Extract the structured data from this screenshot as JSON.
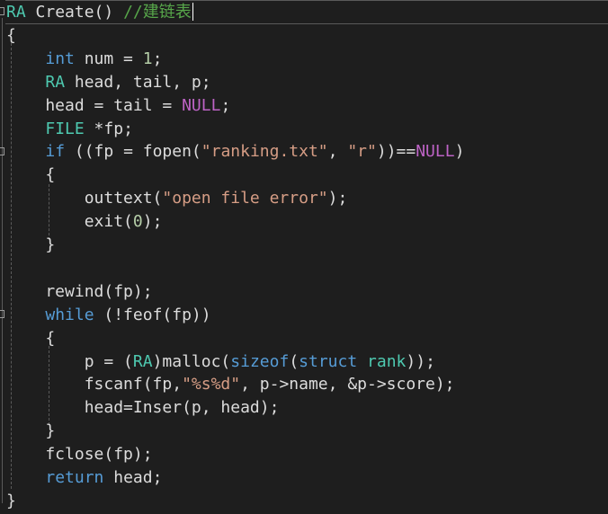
{
  "editor": {
    "lines": [
      [
        {
          "text": "RA",
          "c": "#4ec9b0"
        },
        {
          "text": " Create() ",
          "c": "#dcdcdc"
        },
        {
          "text": "//建链表",
          "c": "#57a64a"
        }
      ],
      [
        {
          "text": "{",
          "c": "#dcdcdc"
        }
      ],
      [
        {
          "text": "    ",
          "c": "#dcdcdc"
        },
        {
          "text": "int",
          "c": "#569cd6"
        },
        {
          "text": " num = ",
          "c": "#dcdcdc"
        },
        {
          "text": "1",
          "c": "#b5cea8"
        },
        {
          "text": ";",
          "c": "#dcdcdc"
        }
      ],
      [
        {
          "text": "    ",
          "c": "#dcdcdc"
        },
        {
          "text": "RA",
          "c": "#4ec9b0"
        },
        {
          "text": " head, tail, p;",
          "c": "#dcdcdc"
        }
      ],
      [
        {
          "text": "    head = tail = ",
          "c": "#dcdcdc"
        },
        {
          "text": "NULL",
          "c": "#bd63c5"
        },
        {
          "text": ";",
          "c": "#dcdcdc"
        }
      ],
      [
        {
          "text": "    ",
          "c": "#dcdcdc"
        },
        {
          "text": "FILE",
          "c": "#4ec9b0"
        },
        {
          "text": " *fp;",
          "c": "#dcdcdc"
        }
      ],
      [
        {
          "text": "    ",
          "c": "#dcdcdc"
        },
        {
          "text": "if",
          "c": "#569cd6"
        },
        {
          "text": " ((fp = fopen(",
          "c": "#dcdcdc"
        },
        {
          "text": "\"ranking.txt\"",
          "c": "#d69d85"
        },
        {
          "text": ", ",
          "c": "#dcdcdc"
        },
        {
          "text": "\"r\"",
          "c": "#d69d85"
        },
        {
          "text": "))==",
          "c": "#dcdcdc"
        },
        {
          "text": "NULL",
          "c": "#bd63c5"
        },
        {
          "text": ")",
          "c": "#dcdcdc"
        }
      ],
      [
        {
          "text": "    {",
          "c": "#dcdcdc"
        }
      ],
      [
        {
          "text": "        outtext(",
          "c": "#dcdcdc"
        },
        {
          "text": "\"open file error\"",
          "c": "#d69d85"
        },
        {
          "text": ");",
          "c": "#dcdcdc"
        }
      ],
      [
        {
          "text": "        exit(",
          "c": "#dcdcdc"
        },
        {
          "text": "0",
          "c": "#b5cea8"
        },
        {
          "text": ");",
          "c": "#dcdcdc"
        }
      ],
      [
        {
          "text": "    }",
          "c": "#dcdcdc"
        }
      ],
      [],
      [
        {
          "text": "    rewind(fp);",
          "c": "#dcdcdc"
        }
      ],
      [
        {
          "text": "    ",
          "c": "#dcdcdc"
        },
        {
          "text": "while",
          "c": "#569cd6"
        },
        {
          "text": " (!feof(fp))",
          "c": "#dcdcdc"
        }
      ],
      [
        {
          "text": "    {",
          "c": "#dcdcdc"
        }
      ],
      [
        {
          "text": "        p = (",
          "c": "#dcdcdc"
        },
        {
          "text": "RA",
          "c": "#4ec9b0"
        },
        {
          "text": ")malloc(",
          "c": "#dcdcdc"
        },
        {
          "text": "sizeof",
          "c": "#569cd6"
        },
        {
          "text": "(",
          "c": "#dcdcdc"
        },
        {
          "text": "struct",
          "c": "#569cd6"
        },
        {
          "text": " ",
          "c": "#dcdcdc"
        },
        {
          "text": "rank",
          "c": "#4ec9b0"
        },
        {
          "text": "));",
          "c": "#dcdcdc"
        }
      ],
      [
        {
          "text": "        fscanf(fp,",
          "c": "#dcdcdc"
        },
        {
          "text": "\"%s%d\"",
          "c": "#d69d85"
        },
        {
          "text": ", p->name, &p->score);",
          "c": "#dcdcdc"
        }
      ],
      [
        {
          "text": "        head=Inser(p, head);",
          "c": "#dcdcdc"
        }
      ],
      [
        {
          "text": "    }",
          "c": "#dcdcdc"
        }
      ],
      [
        {
          "text": "    fclose(fp);",
          "c": "#dcdcdc"
        }
      ],
      [
        {
          "text": "    ",
          "c": "#dcdcdc"
        },
        {
          "text": "return",
          "c": "#569cd6"
        },
        {
          "text": " head;",
          "c": "#dcdcdc"
        }
      ],
      [
        {
          "text": "}",
          "c": "#dcdcdc"
        }
      ]
    ]
  },
  "theme": {
    "background": "#1e1e1e",
    "guide": "#5a5a5a"
  }
}
